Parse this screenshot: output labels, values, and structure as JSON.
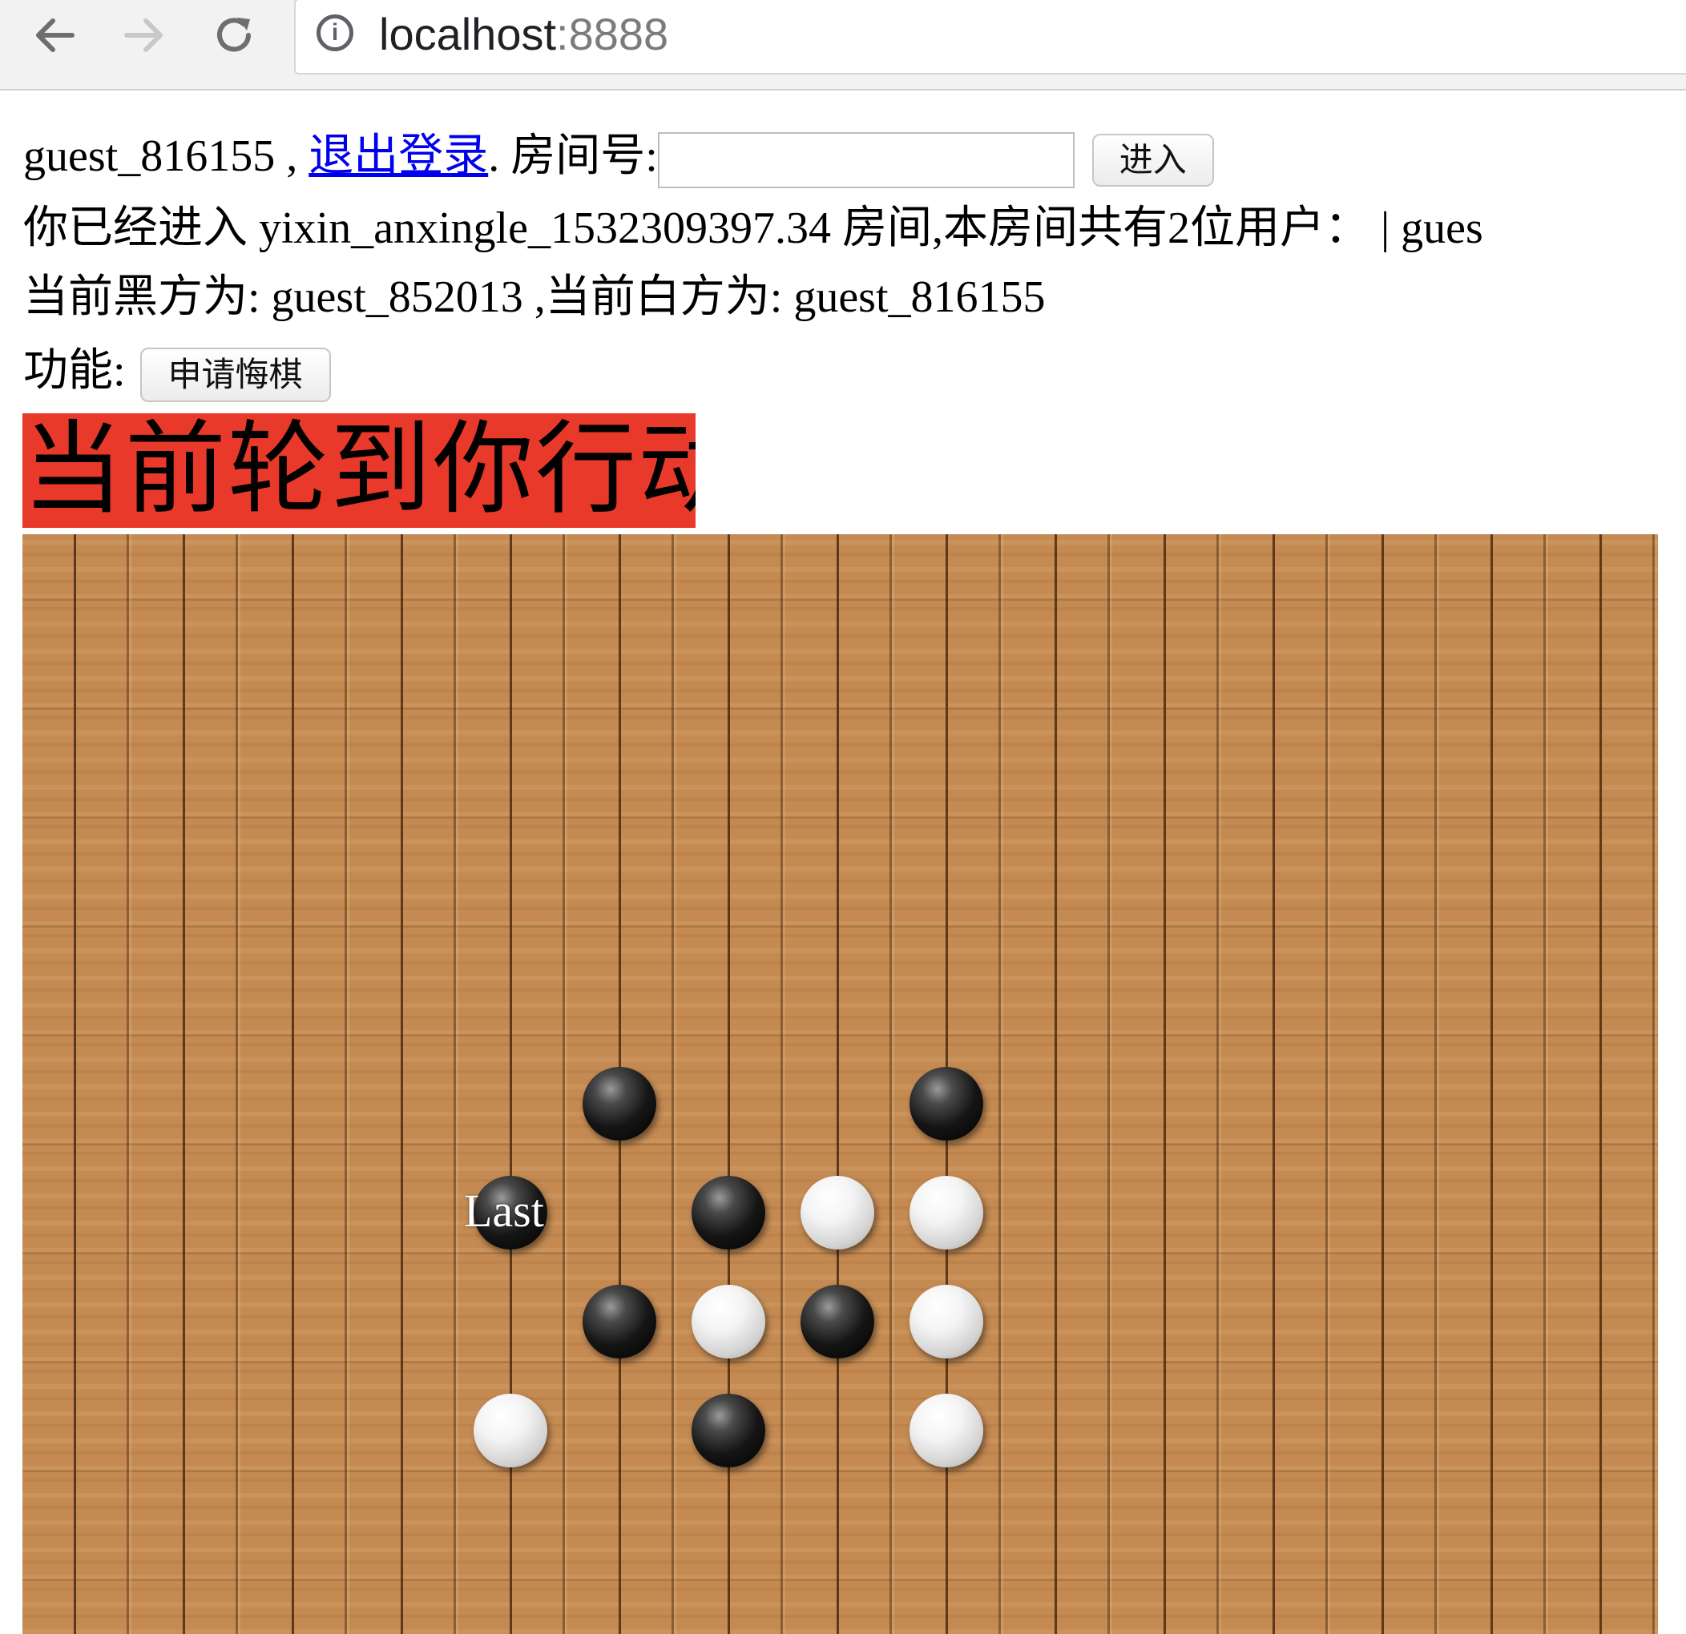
{
  "browser": {
    "url_host": "localhost",
    "url_port": ":8888",
    "icons": [
      "back-arrow-icon",
      "forward-arrow-icon",
      "reload-icon",
      "info-icon"
    ]
  },
  "header": {
    "username": "guest_816155",
    "separator": " , ",
    "logout_label": "退出登录",
    "room_label": ". 房间号:",
    "room_input_value": "",
    "enter_button": "进入"
  },
  "room_info": {
    "text": "你已经进入 yixin_anxingle_1532309397.34 房间,本房间共有2位用户： | gues"
  },
  "players": {
    "text": "当前黑方为:   guest_852013 ,当前白方为:   guest_816155"
  },
  "functions": {
    "label": "功能:",
    "undo_button": "申请悔棋"
  },
  "turn_banner": {
    "text": "当前轮到你行动",
    "color": "#e8392a"
  },
  "board": {
    "last_move_label": "Last",
    "stones": [
      {
        "color": "black",
        "col": 5,
        "row": 5
      },
      {
        "color": "black",
        "col": 8,
        "row": 5
      },
      {
        "color": "black",
        "col": 4,
        "row": 6,
        "last": true
      },
      {
        "color": "black",
        "col": 6,
        "row": 6
      },
      {
        "color": "white",
        "col": 7,
        "row": 6
      },
      {
        "color": "white",
        "col": 8,
        "row": 6
      },
      {
        "color": "black",
        "col": 5,
        "row": 7
      },
      {
        "color": "white",
        "col": 6,
        "row": 7
      },
      {
        "color": "black",
        "col": 7,
        "row": 7
      },
      {
        "color": "white",
        "col": 8,
        "row": 7
      },
      {
        "color": "white",
        "col": 4,
        "row": 8
      },
      {
        "color": "black",
        "col": 6,
        "row": 8
      },
      {
        "color": "white",
        "col": 8,
        "row": 8
      }
    ]
  }
}
